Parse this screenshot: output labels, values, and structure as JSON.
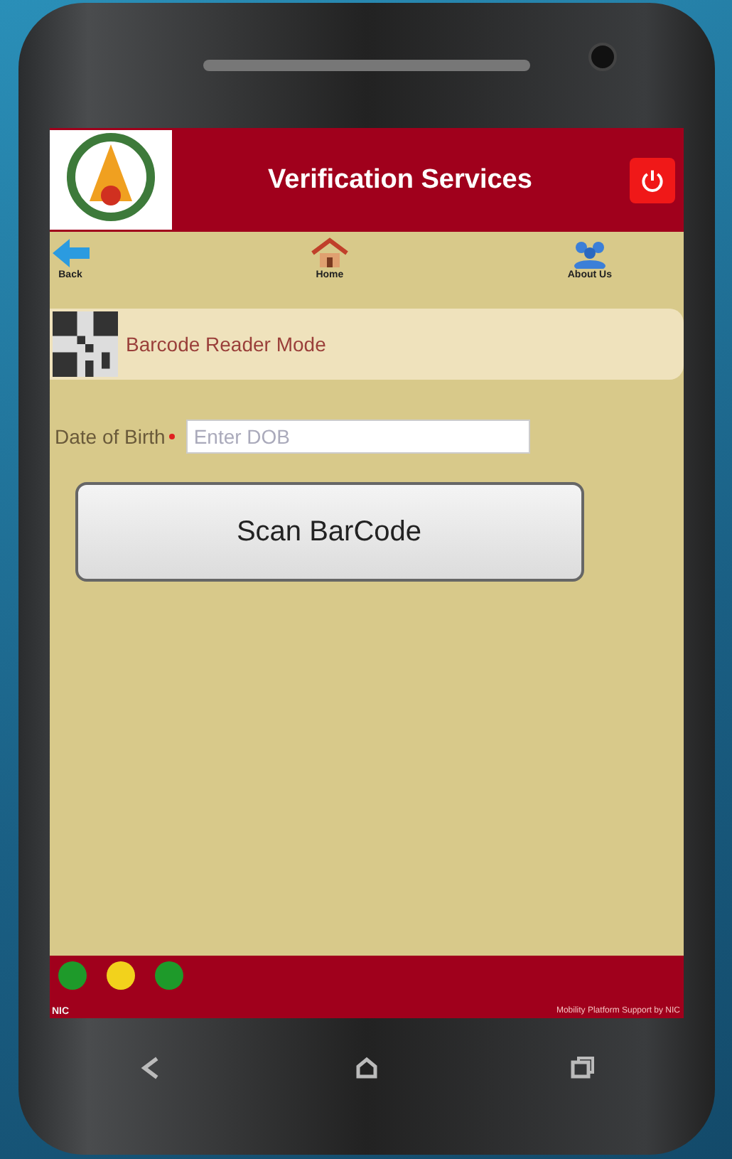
{
  "header": {
    "title": "Verification Services"
  },
  "nav": [
    {
      "label": "Back",
      "kind": "back"
    },
    {
      "label": "Home",
      "kind": "home"
    },
    {
      "label": "About Us",
      "kind": "about"
    }
  ],
  "mode_banner": {
    "label": "Barcode Reader Mode"
  },
  "form": {
    "label": "Date of Birth",
    "required": true,
    "placeholder": "Enter DOB"
  },
  "scan_button": {
    "label": "Scan BarCode"
  },
  "status_lights": [
    {
      "color": "#1e9a2a"
    },
    {
      "color": "#f2d21c"
    },
    {
      "color": "#1e9a2a"
    }
  ],
  "footer": {
    "left": "NIC",
    "right": "Mobility Platform Support by NIC"
  }
}
